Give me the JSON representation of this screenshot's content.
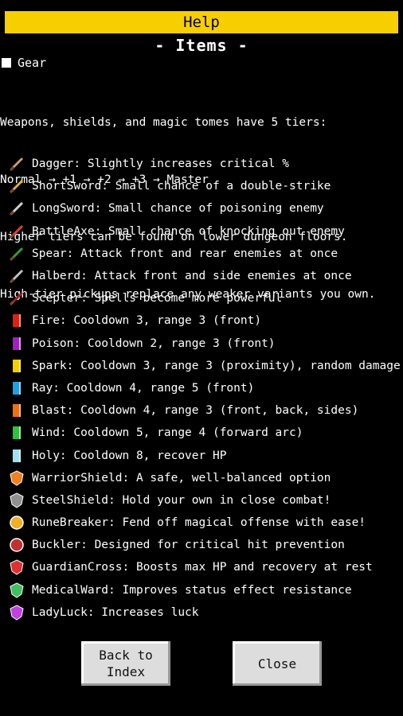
{
  "header": {
    "title": "Help",
    "subtitle": "- Items -"
  },
  "section": {
    "label": "Gear"
  },
  "intro": [
    "Weapons, shields, and magic tomes have 5 tiers:",
    "Normal → +1 → +2 → +3 → Master",
    "Higher tiers can be found on lower dungeon floors.",
    "High-tier pickups replace any weaker variants you own."
  ],
  "items": [
    {
      "text": "Dagger: Slightly increases critical %",
      "icon": "dagger-icon",
      "color": "#c8a060"
    },
    {
      "text": "ShortSword: Small chance of a double-strike",
      "icon": "shortsword-icon",
      "color": "#e0b040"
    },
    {
      "text": "LongSword: Small chance of poisoning enemy",
      "icon": "longsword-icon",
      "color": "#d0d0d0"
    },
    {
      "text": "BattleAxe: Small chance of knocking out enemy",
      "icon": "battleaxe-icon",
      "color": "#e04040"
    },
    {
      "text": "Spear: Attack front and rear enemies at once",
      "icon": "spear-icon",
      "color": "#30a030"
    },
    {
      "text": "Halberd: Attack front and side enemies at once",
      "icon": "halberd-icon",
      "color": "#c0c0c0"
    },
    {
      "text": "Scepter: Spells become more powerful",
      "icon": "scepter-icon",
      "color": "#a02020"
    },
    {
      "text": "Fire: Cooldown 3, range 3 (front)",
      "icon": "fire-tome-icon",
      "color": "#e02010"
    },
    {
      "text": "Poison: Cooldown 2, range 3 (front)",
      "icon": "poison-tome-icon",
      "color": "#a020c0"
    },
    {
      "text": "Spark: Cooldown 3, range 3 (proximity), random damage",
      "icon": "spark-tome-icon",
      "color": "#f0d000"
    },
    {
      "text": "Ray: Cooldown 4, range 5 (front)",
      "icon": "ray-tome-icon",
      "color": "#20a0e0"
    },
    {
      "text": "Blast: Cooldown 4, range 3 (front, back, sides)",
      "icon": "blast-tome-icon",
      "color": "#f07010"
    },
    {
      "text": "Wind: Cooldown 5, range 4 (forward arc)",
      "icon": "wind-tome-icon",
      "color": "#30c040"
    },
    {
      "text": "Holy: Cooldown 8, recover HP",
      "icon": "holy-tome-icon",
      "color": "#a0e0f0"
    },
    {
      "text": "WarriorShield: A safe, well-balanced option",
      "icon": "warriorshield-icon",
      "color": "#f08020"
    },
    {
      "text": "SteelShield: Hold your own in close combat!",
      "icon": "steelshield-icon",
      "color": "#909090"
    },
    {
      "text": "RuneBreaker: Fend off magical offense with ease!",
      "icon": "runebreaker-icon",
      "color": "#f0b020"
    },
    {
      "text": "Buckler: Designed for critical hit prevention",
      "icon": "buckler-icon",
      "color": "#c03030"
    },
    {
      "text": "GuardianCross: Boosts max HP and recovery at rest",
      "icon": "guardiancross-icon",
      "color": "#e03030"
    },
    {
      "text": "MedicalWard: Improves status effect resistance",
      "icon": "medicalward-icon",
      "color": "#40c060"
    },
    {
      "text": "LadyLuck: Increases luck",
      "icon": "ladyluck-icon",
      "color": "#c040e0"
    }
  ],
  "buttons": {
    "back": "Back to\nIndex",
    "close": "Close"
  }
}
